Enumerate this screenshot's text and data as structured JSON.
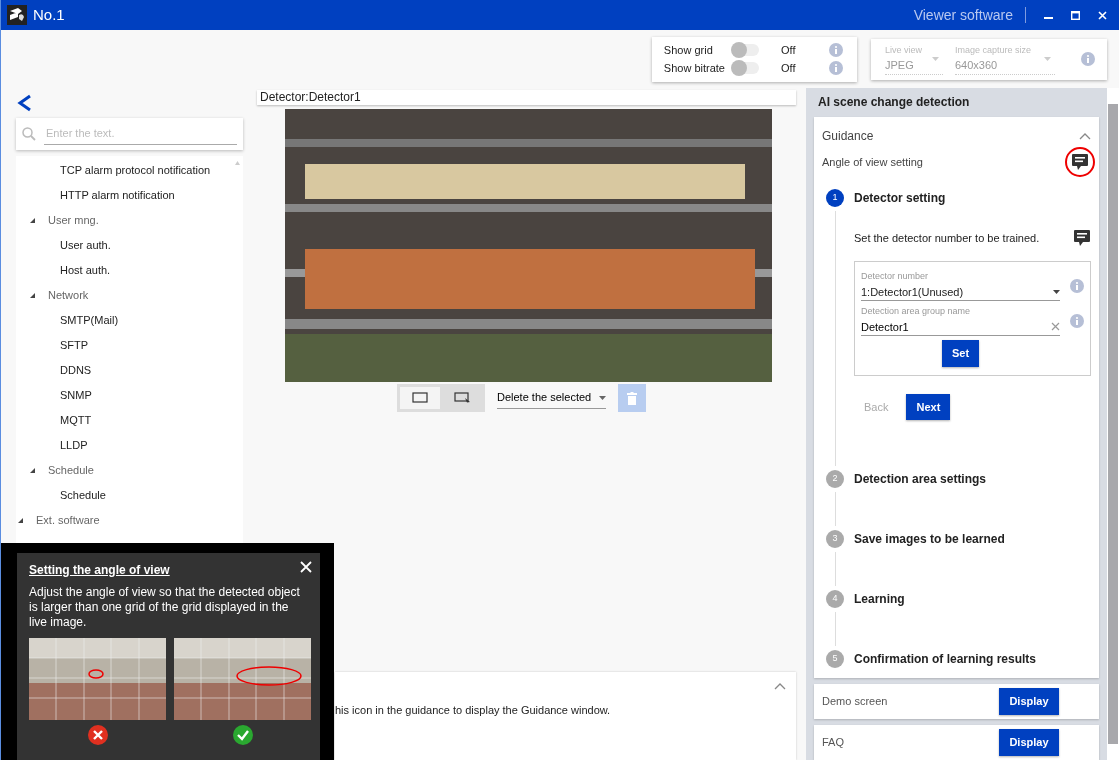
{
  "window": {
    "title": "No.1",
    "app_name": "Viewer software"
  },
  "display_options": [
    {
      "label": "Show grid",
      "on": false,
      "value": "Off"
    },
    {
      "label": "Show bitrate",
      "on": false,
      "value": "Off"
    }
  ],
  "stream_settings": [
    {
      "label": "Live view",
      "value": "JPEG",
      "disabled": true
    },
    {
      "label": "Image capture size",
      "value": "640x360",
      "disabled": true
    }
  ],
  "sidebar": {
    "search": {
      "placeholder": "Enter the text."
    },
    "tree": [
      {
        "children": [
          {
            "children": [
              {
                "label": "TCP alarm protocol notification"
              },
              {
                "label": "HTTP alarm notification"
              }
            ]
          },
          {
            "label": "User mng.",
            "expanded": true,
            "children": [
              {
                "label": "User auth."
              },
              {
                "label": "Host auth."
              }
            ]
          },
          {
            "label": "Network",
            "expanded": true,
            "children": [
              {
                "label": "SMTP(Mail)"
              },
              {
                "label": "SFTP"
              },
              {
                "label": "DDNS"
              },
              {
                "label": "SNMP"
              },
              {
                "label": "MQTT"
              },
              {
                "label": "LLDP"
              }
            ]
          },
          {
            "label": "Schedule",
            "expanded": true,
            "children": [
              {
                "label": "Schedule"
              }
            ]
          }
        ]
      },
      {
        "label": "Ext. software",
        "expanded": true
      }
    ]
  },
  "viewer": {
    "detector_label": "Detector:Detector1",
    "draw_modes": [
      {
        "kind": "rectangle",
        "selected": true
      },
      {
        "kind": "rectangle-cursor",
        "selected": false
      }
    ],
    "delete_select": "Delete the selected",
    "delete_disabled": true
  },
  "hint_panel": {
    "text": "his icon in the guidance to display the Guidance window.",
    "expanded": true
  },
  "ai_panel": {
    "title": "AI scene change detection",
    "guidance": {
      "title": "Guidance",
      "expanded": true,
      "subtitle": "Angle of view setting",
      "highlighted": true,
      "steps": [
        {
          "number": "1",
          "title": "Detector setting",
          "active": true,
          "content": {
            "instruction": "Set the detector number to be trained.",
            "fields": [
              {
                "kind": "select",
                "label": "Detector number",
                "value": "1:Detector1(Unused)"
              },
              {
                "kind": "text",
                "label": "Detection area group name",
                "value": "Detector1"
              }
            ],
            "set_button": "Set",
            "back_button": {
              "label": "Back",
              "disabled": true
            },
            "next_button": {
              "label": "Next",
              "disabled": false
            }
          }
        },
        {
          "number": "2",
          "title": "Detection area settings",
          "active": false
        },
        {
          "number": "3",
          "title": "Save images to be learned",
          "active": false
        },
        {
          "number": "4",
          "title": "Learning",
          "active": false
        },
        {
          "number": "5",
          "title": "Confirmation of learning results",
          "active": false
        }
      ]
    },
    "links": [
      {
        "label": "Demo screen",
        "button": "Display"
      },
      {
        "label": "FAQ",
        "button": "Display"
      }
    ]
  },
  "popup": {
    "title": "Setting the angle of view",
    "text": "Adjust the angle of view so that the detected object is larger than one grid of the grid displayed in the live image.",
    "examples": [
      {
        "good": false
      },
      {
        "good": true
      }
    ]
  }
}
